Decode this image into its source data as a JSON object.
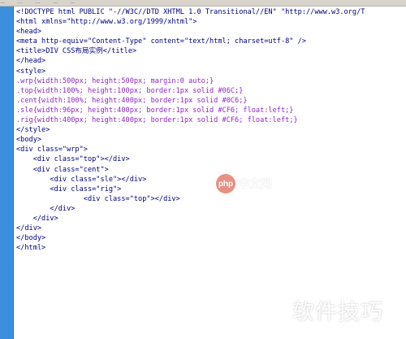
{
  "toolbar": {
    "items": [
      "…",
      "…",
      "…",
      "…",
      "…"
    ]
  },
  "code_lines": [
    "<!DOCTYPE html PUBLIC \"-//W3C//DTD XHTML 1.0 Transitional//EN\" \"http://www.w3.org/T",
    "<html xmlns=\"http://www.w3.org/1999/xhtml\">",
    "<head>",
    "<meta http-equiv=\"Content-Type\" content=\"text/html; charset=utf-8\" />",
    "<title>DIV CSS布局实例</title>",
    "</head>",
    "<style>",
    ".wrp{width:500px; height:500px; margin:0 auto;}",
    ".top{width:100%; height:100px; border:1px solid #06C;}",
    ".cent{width:100%; height:400px; border:1px solid #0C6;}",
    ".sle{width:96px; height:400px; border:1px solid #CF6; float:left;}",
    ".rig{width:400px; height:400px; border:1px solid #CF6; float:left;}",
    "</style>",
    "<body>",
    "<div class=\"wrp\">",
    "    <div class=\"top\"></div>",
    "    <div class=\"cent\">",
    "        <div class=\"sle\"></div>",
    "        <div class=\"rig\">",
    "                <div class=\"top\"></div>",
    "        </div>",
    "    </div>",
    "</div>",
    "</body>",
    "</html>"
  ],
  "watermark": {
    "logo": "php",
    "text": "中文网"
  },
  "watermark_bottom": "软件技巧"
}
